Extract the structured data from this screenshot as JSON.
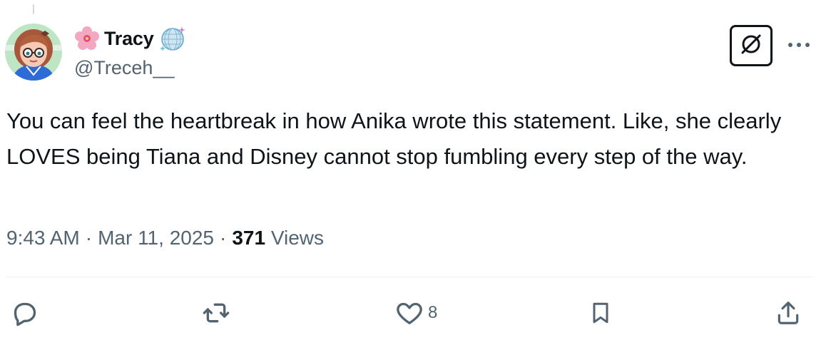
{
  "author": {
    "flower_emoji": "cherry-blossom",
    "display_name": "Tracy",
    "badge_emoji": "mirror-ball",
    "handle": "@Treceh__"
  },
  "tweet": {
    "text": "You can feel the heartbreak in how Anika wrote this statement. Like, she clearly LOVES being Tiana and Disney cannot stop fumbling every step of the way."
  },
  "meta": {
    "time": "9:43 AM",
    "separator": "·",
    "date": "Mar 11, 2025",
    "views_count": "371",
    "views_label": "Views"
  },
  "actions": {
    "reply_icon": "reply-icon",
    "repost_icon": "repost-icon",
    "like_icon": "heart-icon",
    "like_count": "8",
    "bookmark_icon": "bookmark-icon",
    "share_icon": "share-icon"
  },
  "colors": {
    "text_primary": "#0f1419",
    "text_secondary": "#536471",
    "divider": "#eff3f4"
  }
}
